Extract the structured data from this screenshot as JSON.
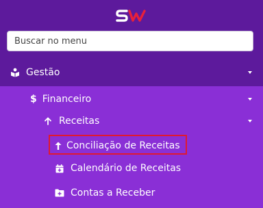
{
  "brand": {
    "logo_text": "SW",
    "colors": {
      "s": "#ffffff",
      "w": "#e8203a"
    }
  },
  "search": {
    "placeholder": "Buscar no menu",
    "value": ""
  },
  "menu": {
    "gestao": {
      "label": "Gestão",
      "icon": "book-reader-icon"
    },
    "financeiro": {
      "label": "Financeiro",
      "icon": "dollar-icon"
    },
    "receitas": {
      "label": "Receitas",
      "icon": "arrow-up-icon"
    },
    "items": [
      {
        "label": "Conciliação de Receitas",
        "icon": "arrow-up-icon",
        "highlighted": true
      },
      {
        "label": "Calendário de Receitas",
        "icon": "calendar-plus-icon"
      },
      {
        "label": "Contas a Receber",
        "icon": "folder-plus-icon"
      }
    ]
  },
  "colors": {
    "header_bg": "#5d1a9c",
    "menu_bg": "#8a2fd6",
    "highlight": "#e0192f"
  }
}
